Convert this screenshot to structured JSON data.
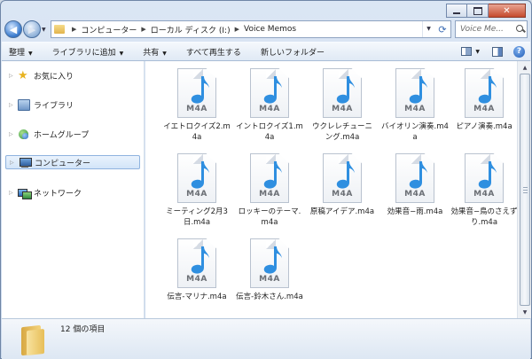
{
  "window": {
    "caption_buttons": [
      "minimize",
      "maximize",
      "close"
    ]
  },
  "address_bar": {
    "breadcrumbs": [
      "コンピューター",
      "ローカル ディスク (I:)",
      "Voice Memos"
    ]
  },
  "search": {
    "placeholder": "Voice Me..."
  },
  "toolbar": {
    "organize": "整理",
    "add_to_library": "ライブラリに追加",
    "share": "共有",
    "play_all": "すべて再生する",
    "new_folder": "新しいフォルダー"
  },
  "nav_pane": {
    "items": [
      {
        "label": "お気に入り",
        "icon": "star-icon"
      },
      {
        "label": "ライブラリ",
        "icon": "library-icon"
      },
      {
        "label": "ホームグループ",
        "icon": "homegroup-icon"
      },
      {
        "label": "コンピューター",
        "icon": "computer-icon",
        "selected": true
      },
      {
        "label": "ネットワーク",
        "icon": "network-icon"
      }
    ]
  },
  "files": [
    {
      "name": "イエトロクイズ2.m4a",
      "ext": "M4A"
    },
    {
      "name": "イントロクイズ1.m4a",
      "ext": "M4A"
    },
    {
      "name": "ウクレレチューニング.m4a",
      "ext": "M4A"
    },
    {
      "name": "バイオリン演奏.m4a",
      "ext": "M4A"
    },
    {
      "name": "ピアノ演奏.m4a",
      "ext": "M4A"
    },
    {
      "name": "ミーティング2月3日.m4a",
      "ext": "M4A"
    },
    {
      "name": "ロッキーのテーマ.m4a",
      "ext": "M4A"
    },
    {
      "name": "原稿アイデア.m4a",
      "ext": "M4A"
    },
    {
      "name": "効果音−雨.m4a",
      "ext": "M4A"
    },
    {
      "name": "効果音−鳥のさえずり.m4a",
      "ext": "M4A"
    },
    {
      "name": "伝言-マリナ.m4a",
      "ext": "M4A"
    },
    {
      "name": "伝言-鈴木さん.m4a",
      "ext": "M4A"
    }
  ],
  "details": {
    "item_count": "12 個の項目"
  },
  "colors": {
    "note_fill": "#2f8fe0",
    "selection": "#d2e4f8"
  }
}
